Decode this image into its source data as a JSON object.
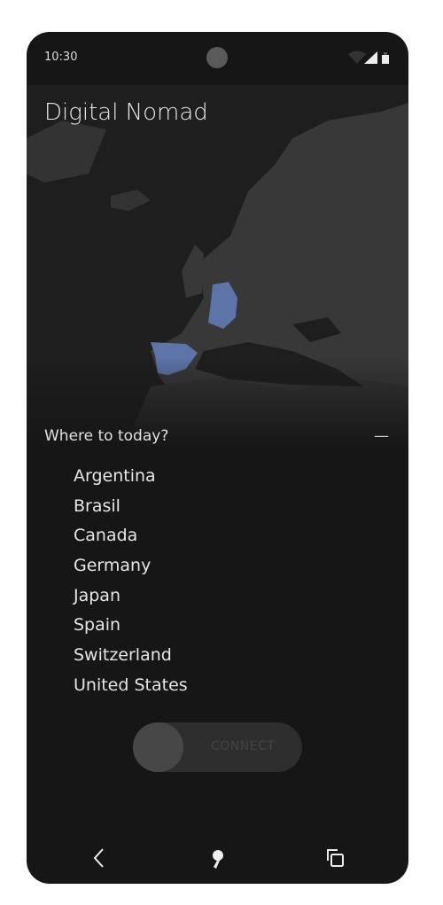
{
  "status_bar": {
    "time": "10:30"
  },
  "app": {
    "title": "Digital Nomad"
  },
  "map": {
    "highlighted_countries": [
      "Germany",
      "Spain"
    ],
    "highlight_color": "#5d74a8",
    "land_color": "#3a3a3a"
  },
  "destination": {
    "prompt": "Where to today?",
    "collapse_icon": "minus-icon",
    "countries": [
      "Argentina",
      "Brasil",
      "Canada",
      "Germany",
      "Japan",
      "Spain",
      "Switzerland",
      "United States"
    ]
  },
  "connect": {
    "label": "CONNECT",
    "state": "off"
  },
  "nav": {
    "back": "back-icon",
    "home": "home-icon",
    "recents": "recents-icon"
  }
}
